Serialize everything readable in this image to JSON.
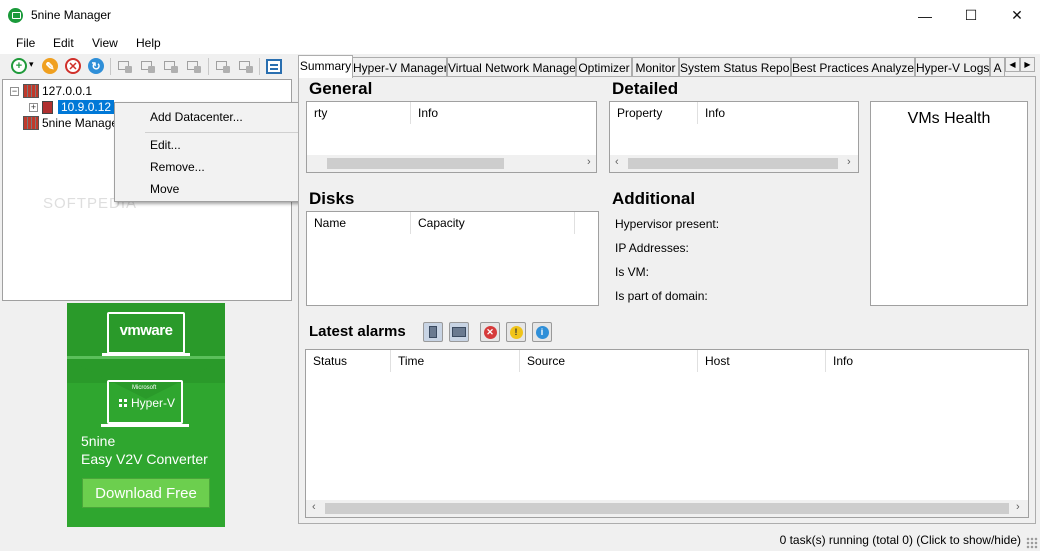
{
  "window": {
    "title": "5nine Manager",
    "minimize": "—",
    "maximize": "☐",
    "close": "✕"
  },
  "menu": [
    "File",
    "Edit",
    "View",
    "Help"
  ],
  "toolbar": {
    "add_icon": "plus-circle-icon",
    "dropdown": "▾",
    "edit_icon": "pencil-icon",
    "remove_icon": "x-circle-icon",
    "refresh_icon": "refresh-icon"
  },
  "tree": {
    "root": "127.0.0.1",
    "child": "10.9.0.12",
    "sibling": "5nine Manage"
  },
  "watermark": "SOFTPEDIA",
  "context_menu": [
    "Add Datacenter...",
    "Edit...",
    "Remove...",
    "Move"
  ],
  "ad": {
    "vmware": "vmware",
    "hyperv_small": "Microsoft",
    "hyperv": "Hyper-V",
    "brand": "5nine",
    "product": "Easy V2V Converter",
    "button": "Download Free"
  },
  "tabs": [
    "Summary",
    "Hyper-V Manager",
    "Virtual Network Manager",
    "Optimizer",
    "Monitor",
    "System Status Report",
    "Best Practices Analyzer",
    "Hyper-V Logs",
    "A"
  ],
  "general": {
    "title": "General",
    "col1": "rty",
    "col2": "Info"
  },
  "detailed": {
    "title": "Detailed",
    "col1": "Property",
    "col2": "Info"
  },
  "vms_health": {
    "title": "VMs Health"
  },
  "disks": {
    "title": "Disks",
    "col1": "Name",
    "col2": "Capacity"
  },
  "additional": {
    "title": "Additional",
    "items": [
      "Hypervisor present:",
      "IP Addresses:",
      "Is VM:",
      "Is part of domain:"
    ]
  },
  "alarms": {
    "title": "Latest alarms",
    "columns": [
      "Status",
      "Time",
      "Source",
      "Host",
      "Info"
    ],
    "colors": {
      "error": "#d63a3a",
      "warning": "#f0c419",
      "info": "#2f8fd8"
    }
  },
  "status": {
    "text": "0 task(s) running (total 0) (Click to show/hide)"
  }
}
